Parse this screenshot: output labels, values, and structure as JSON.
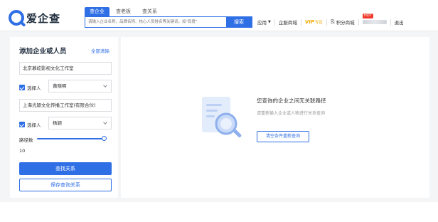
{
  "header": {
    "logo_text": "爱企查",
    "tabs": [
      {
        "label": "查企业"
      },
      {
        "label": "查老板"
      },
      {
        "label": "查关系"
      }
    ],
    "search": {
      "placeholder": "请输入企业名称、品牌名称、核心人员姓名等关键词，如\"百度\"",
      "button_label": "搜索"
    },
    "nav": {
      "app_label": "应用",
      "enterprise_mall": "企服商城",
      "vip_label": "VIP",
      "vip_sub": "专区",
      "hot_badge": "HOT",
      "points_mall": "积分商城",
      "logout": "退出"
    }
  },
  "panel": {
    "title": "添加企业或人员",
    "clear_all": "全部清除",
    "entity_1": "北京慕屹影视文化工作室",
    "select_person_label": "选择人",
    "person_1": "黄晓明",
    "entity_2": "上海光颖文化传播工作室(有限合伙)",
    "person_2": "杨颖",
    "path_label": "路径数",
    "path_value": "10",
    "find_button": "查找关系",
    "save_button": "保存查询关系"
  },
  "result": {
    "empty_title": "您查询的企业之间无关联路径",
    "empty_subtitle": "请重新输入企业或人物进行关系查询",
    "reset_button": "清空条件重新查询"
  },
  "colors": {
    "accent": "#2f6fe6",
    "hot": "#f03a2e",
    "vip": "#f0a800"
  }
}
